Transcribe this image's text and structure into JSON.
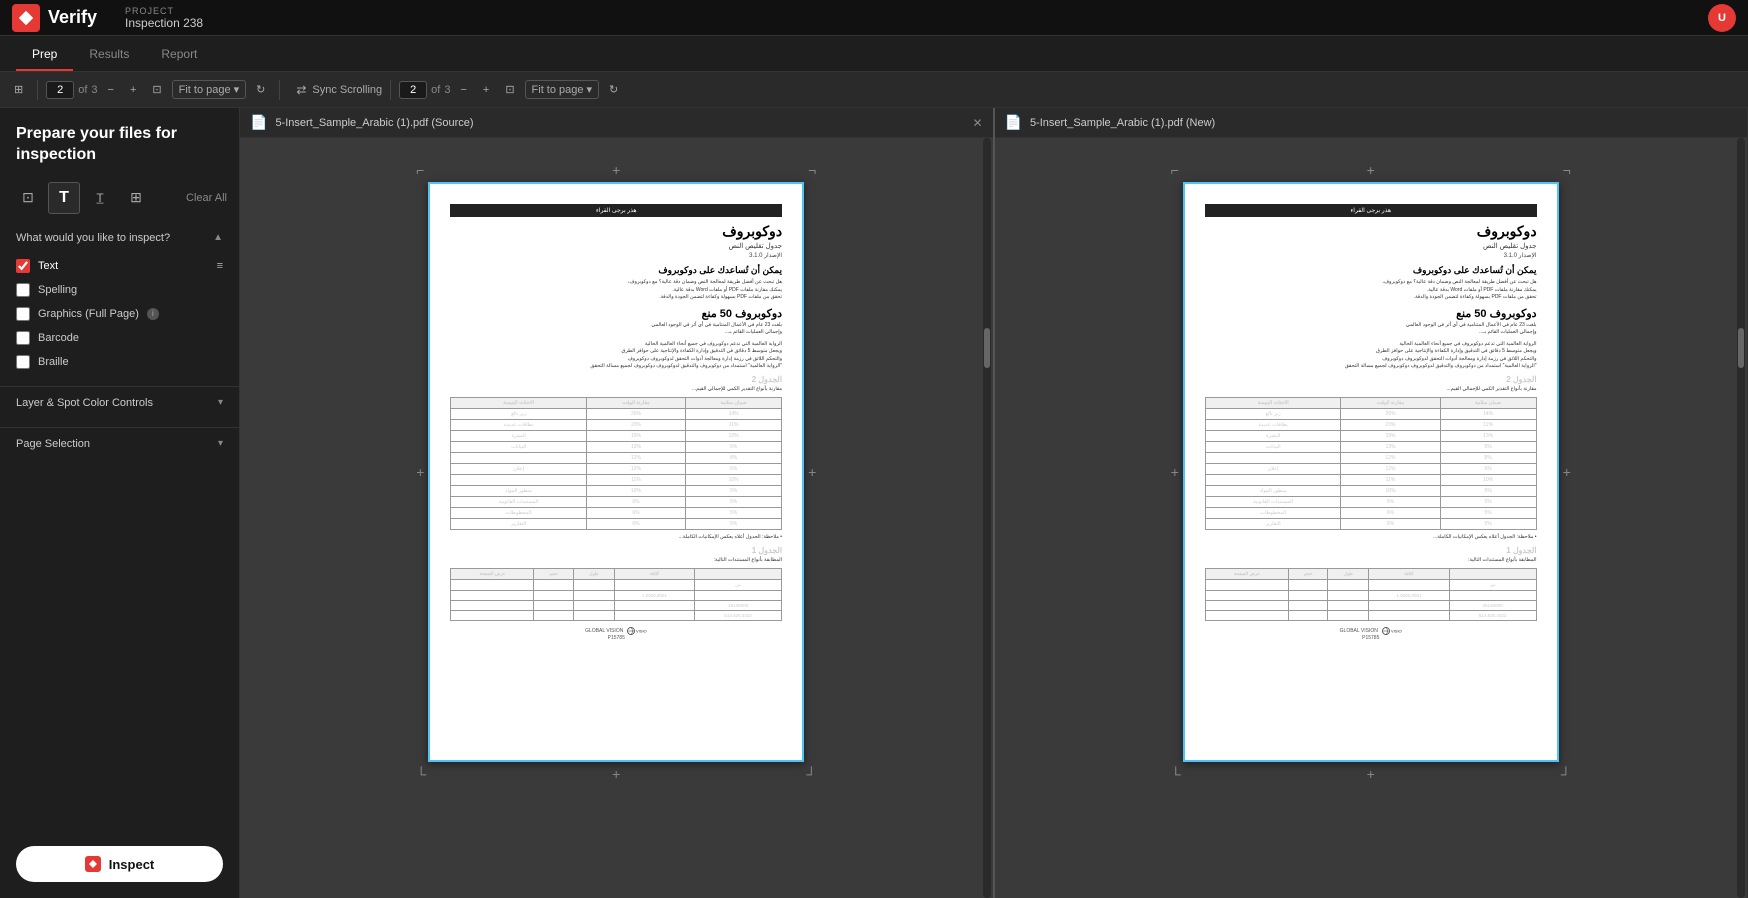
{
  "app": {
    "name": "Verify",
    "logo_text": "Verify"
  },
  "project": {
    "label": "PROJECT",
    "name": "Inspection 238"
  },
  "nav": {
    "tabs": [
      {
        "id": "prep",
        "label": "Prep",
        "active": true
      },
      {
        "id": "results",
        "label": "Results",
        "active": false
      },
      {
        "id": "report",
        "label": "Report",
        "active": false
      }
    ]
  },
  "toolbar_left": {
    "page_num": "2",
    "page_total": "3",
    "fit_label": "Fit to page",
    "fit_icon": "▼"
  },
  "toolbar_right": {
    "sync_label": "Sync Scrolling",
    "page_num": "2",
    "page_total": "3",
    "fit_label": "Fit to page",
    "fit_icon": "▼"
  },
  "sidebar": {
    "title": "Prepare your files for inspection",
    "tools": [
      {
        "id": "crop",
        "label": "Crop tool",
        "icon": "⊡"
      },
      {
        "id": "text",
        "label": "Text tool",
        "icon": "T"
      },
      {
        "id": "text2",
        "label": "Text alt tool",
        "icon": "T"
      },
      {
        "id": "region",
        "label": "Region tool",
        "icon": "⊞"
      }
    ],
    "clear_label": "Clear All",
    "inspect_section": {
      "label": "What would you like to inspect?",
      "options": [
        {
          "id": "text",
          "label": "Text",
          "checked": true,
          "has_filter": true
        },
        {
          "id": "spelling",
          "label": "Spelling",
          "checked": false
        },
        {
          "id": "graphics",
          "label": "Graphics (Full Page)",
          "checked": false,
          "has_info": true
        },
        {
          "id": "barcode",
          "label": "Barcode",
          "checked": false
        },
        {
          "id": "braille",
          "label": "Braille",
          "checked": false
        }
      ]
    },
    "layer_section": {
      "label": "Layer & Spot Color Controls"
    },
    "page_section": {
      "label": "Page Selection"
    },
    "inspect_btn": "Inspect"
  },
  "left_panel": {
    "title": "5-Insert_Sample_Arabic (1).pdf (Source)",
    "doc_header": "هذر برجى القراء",
    "main_title": "دوكوبروف",
    "subtitle": "جدول تقليص النص",
    "version": "الإصدار 3.1.0",
    "section1_title": "يمكن أن تُساعدك على دوكوبروف",
    "offer_title": "دوكوبروف 50 منع",
    "table_section": "الجدول 2",
    "table_section2": "الجدول 1",
    "footer_text": "GLOBAL VISION",
    "page_id": "P15785"
  },
  "right_panel": {
    "title": "5-Insert_Sample_Arabic (1).pdf (New)",
    "doc_header": "هذر برجى القراء",
    "main_title": "دوكوبروف",
    "subtitle": "جدول تقليص النص",
    "version": "الإصدار 3.1.0",
    "section1_title": "يمكن أن تُساعدك على دوكوبروف",
    "offer_title": "دوكوبروف 50 منع",
    "table_section": "الجدول 2",
    "table_section2": "الجدول 1",
    "footer_text": "GLOBAL VISION",
    "page_id": "P15785"
  },
  "icons": {
    "chevron_down": "▾",
    "chevron_right": "▸",
    "refresh": "↻",
    "minus": "−",
    "plus": "+",
    "sync": "⇄",
    "close": "×",
    "pdf": "📄",
    "cross": "+",
    "corner_tl": "⌐",
    "corner_tr": "¬",
    "corner_bl": "└",
    "corner_br": "┘"
  },
  "colors": {
    "accent": "#e53935",
    "bg_dark": "#1a1a1a",
    "bg_panel": "#1e1e1e",
    "bg_toolbar": "#2a2a2a",
    "border": "#333333",
    "doc_border": "#4fc3f7"
  }
}
